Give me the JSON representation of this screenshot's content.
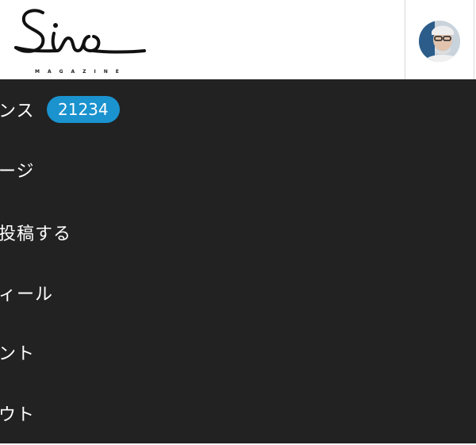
{
  "header": {
    "logo_text": "Sino",
    "logo_sub": "MAGAZINE"
  },
  "menu": {
    "items": [
      {
        "label": "ンス",
        "badge": "21234"
      },
      {
        "label": "ージ"
      },
      {
        "label": "投稿する"
      },
      {
        "label": "ィール"
      },
      {
        "label": "ント"
      },
      {
        "label": "ウト"
      }
    ]
  },
  "colors": {
    "menu_bg": "#222222",
    "badge_bg": "#1a93cf",
    "header_bg": "#ffffff"
  },
  "icons": {
    "avatar": "user-avatar-photo"
  }
}
